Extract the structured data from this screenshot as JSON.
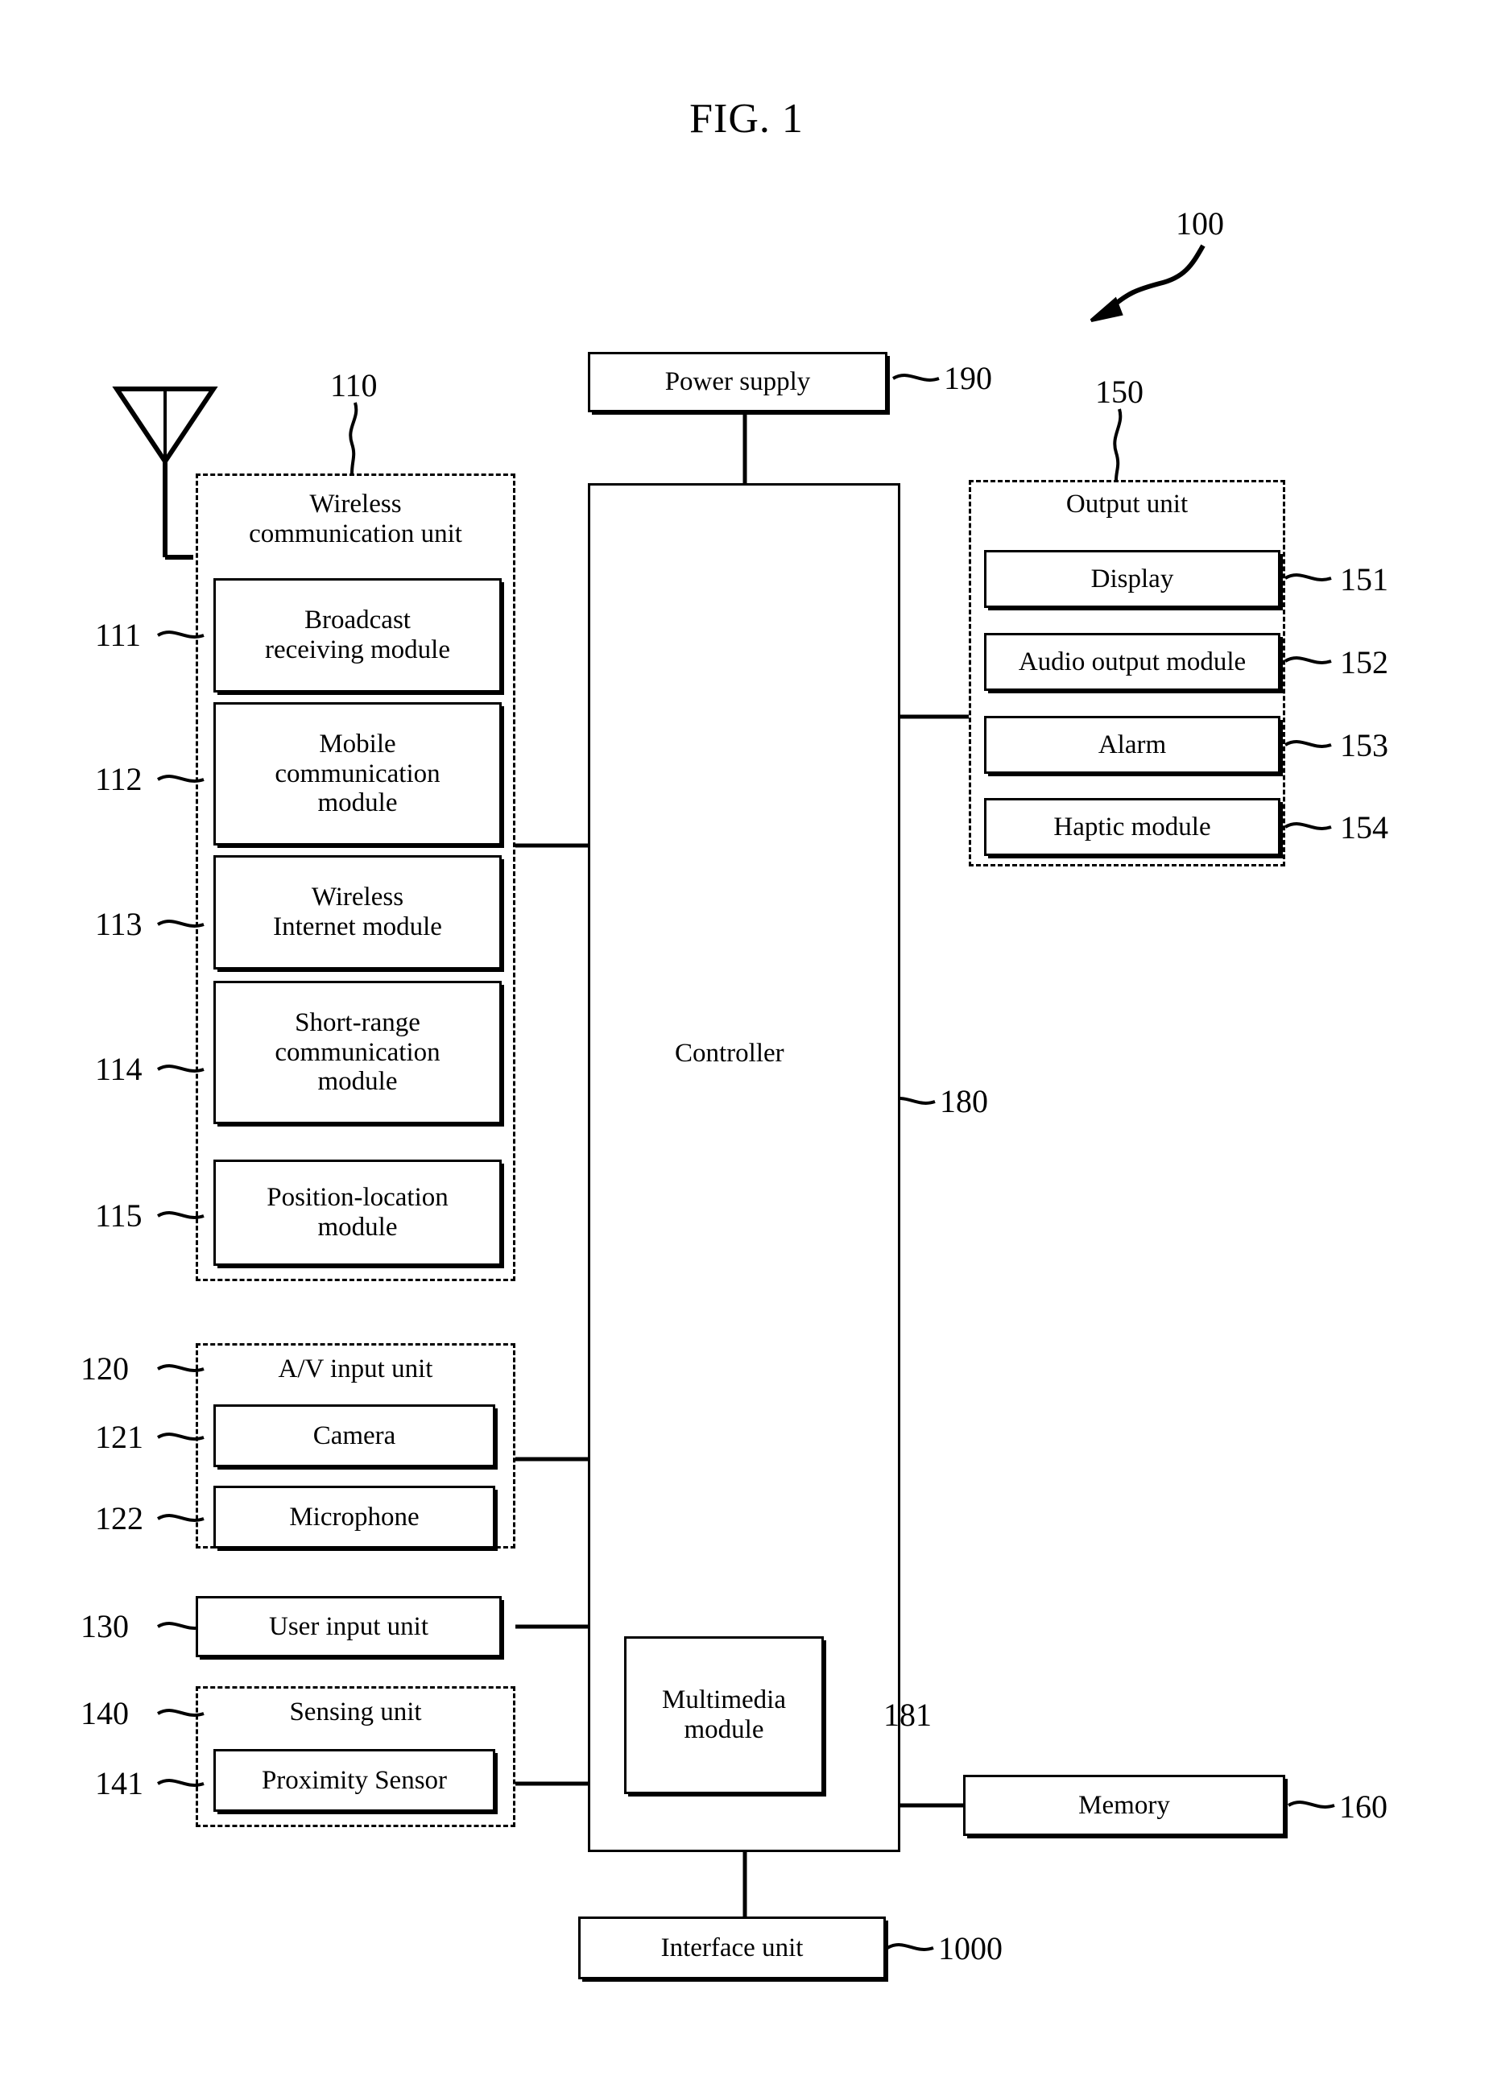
{
  "figure": {
    "title": "FIG. 1",
    "system_ref": "100"
  },
  "blocks": {
    "power_supply": {
      "label": "Power supply",
      "ref": "190"
    },
    "controller": {
      "label": "Controller",
      "ref": "180"
    },
    "multimedia_module": {
      "label": "Multimedia\nmodule",
      "ref": "181"
    },
    "memory": {
      "label": "Memory",
      "ref": "160"
    },
    "interface_unit": {
      "label": "Interface unit",
      "ref": "1000"
    },
    "user_input_unit": {
      "label": "User input unit",
      "ref": "130"
    }
  },
  "wireless_communication_unit": {
    "title": "Wireless\ncommunication unit",
    "ref": "110",
    "modules": [
      {
        "label": "Broadcast\nreceiving module",
        "ref": "111"
      },
      {
        "label": "Mobile\ncommunication\nmodule",
        "ref": "112"
      },
      {
        "label": "Wireless\nInternet module",
        "ref": "113"
      },
      {
        "label": "Short-range\ncommunication\nmodule",
        "ref": "114"
      },
      {
        "label": "Position-location\nmodule",
        "ref": "115"
      }
    ]
  },
  "av_input_unit": {
    "title": "A/V input unit",
    "ref": "120",
    "modules": [
      {
        "label": "Camera",
        "ref": "121"
      },
      {
        "label": "Microphone",
        "ref": "122"
      }
    ]
  },
  "sensing_unit": {
    "title": "Sensing unit",
    "ref": "140",
    "modules": [
      {
        "label": "Proximity Sensor",
        "ref": "141"
      }
    ]
  },
  "output_unit": {
    "title": "Output unit",
    "ref": "150",
    "modules": [
      {
        "label": "Display",
        "ref": "151"
      },
      {
        "label": "Audio output module",
        "ref": "152"
      },
      {
        "label": "Alarm",
        "ref": "153"
      },
      {
        "label": "Haptic module",
        "ref": "154"
      }
    ]
  },
  "icons": {
    "antenna": "antenna-icon",
    "system_arrow": "system-pointer-arrow-icon"
  },
  "colors": {
    "stroke": "#000000",
    "background": "#ffffff"
  }
}
